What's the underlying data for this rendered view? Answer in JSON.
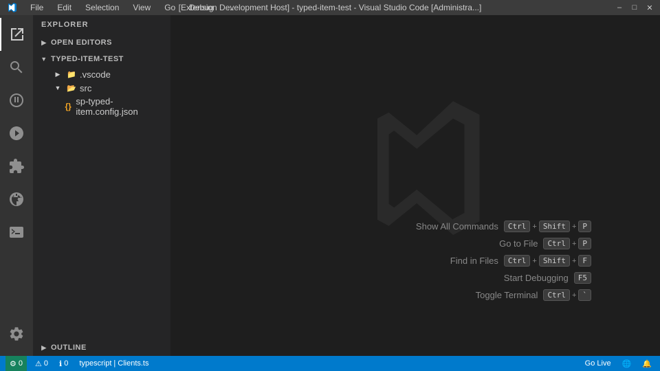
{
  "titlebar": {
    "menu_items": [
      "File",
      "Edit",
      "Selection",
      "View",
      "Go",
      "Debug",
      "..."
    ],
    "title": "[Extension Development Host] - typed-item-test - Visual Studio Code [Administra...]",
    "controls": {
      "minimize": "–",
      "maximize": "□",
      "close": "✕"
    }
  },
  "sidebar": {
    "header": "Explorer",
    "sections": {
      "open_editors": "Open Editors",
      "project": "typed-item-test",
      "outline": "Outline"
    },
    "tree": [
      {
        "label": ".vscode",
        "type": "folder",
        "depth": 1,
        "color": "blue",
        "collapsed": true
      },
      {
        "label": "src",
        "type": "folder",
        "depth": 1,
        "color": "green",
        "collapsed": false
      },
      {
        "label": "sp-typed-item.config.json",
        "type": "file",
        "depth": 2,
        "icon": "{}"
      }
    ]
  },
  "shortcuts": [
    {
      "label": "Show All Commands",
      "keys": [
        "Ctrl",
        "+",
        "Shift",
        "+",
        "P"
      ]
    },
    {
      "label": "Go to File",
      "keys": [
        "Ctrl",
        "+",
        "P"
      ]
    },
    {
      "label": "Find in Files",
      "keys": [
        "Ctrl",
        "+",
        "Shift",
        "+",
        "F"
      ]
    },
    {
      "label": "Start Debugging",
      "keys": [
        "F5"
      ]
    },
    {
      "label": "Toggle Terminal",
      "keys": [
        "Ctrl",
        "+",
        "`"
      ]
    }
  ],
  "statusbar": {
    "left": [
      {
        "icon": "⚙",
        "text": "0"
      },
      {
        "icon": "⚠",
        "text": "0"
      },
      {
        "icon": "ℹ",
        "text": "0"
      }
    ],
    "language": "typescript",
    "file": "Clients.ts",
    "live": "Go Live",
    "right_icons": [
      "🌐",
      "🔔"
    ]
  }
}
